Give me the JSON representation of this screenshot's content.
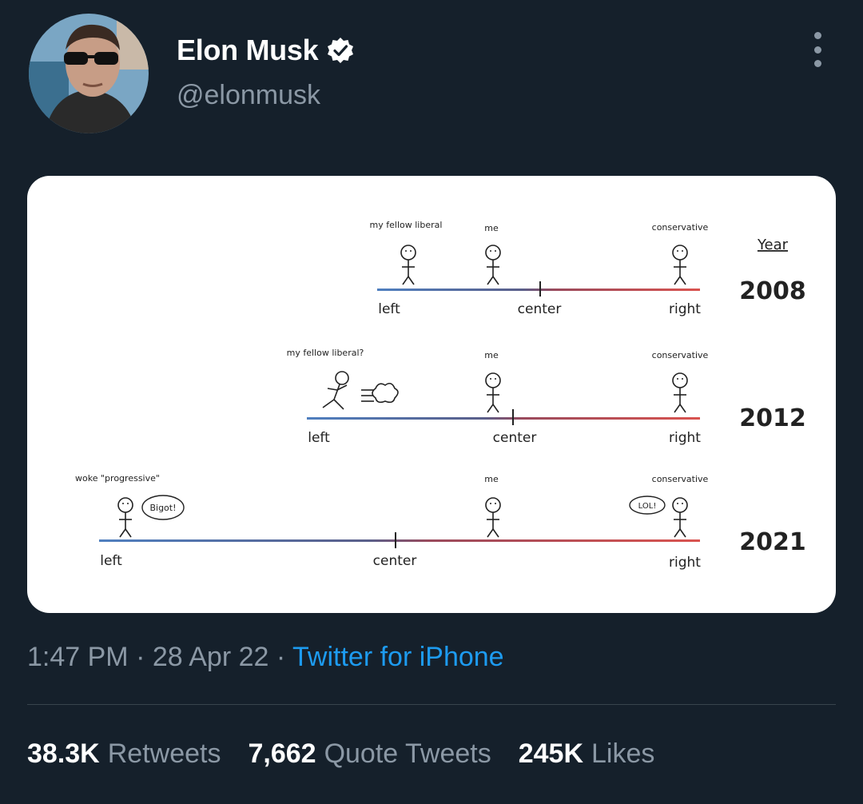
{
  "author": {
    "name": "Elon Musk",
    "handle": "@elonmusk",
    "verified": true
  },
  "meme": {
    "year_header": "Year",
    "panels": [
      {
        "year": "2008",
        "labels": {
          "left": "left",
          "center": "center",
          "right": "right"
        },
        "figures": {
          "liberal": "my fellow liberal",
          "me": "me",
          "conservative": "conservative"
        }
      },
      {
        "year": "2012",
        "labels": {
          "left": "left",
          "center": "center",
          "right": "right"
        },
        "figures": {
          "liberal": "my fellow liberal?",
          "me": "me",
          "conservative": "conservative"
        }
      },
      {
        "year": "2021",
        "labels": {
          "left": "left",
          "center": "center",
          "right": "right"
        },
        "figures": {
          "liberal": "woke \"progressive\"",
          "me": "me",
          "conservative": "conservative"
        },
        "speech_left": "Bigot!",
        "speech_right": "LOL!"
      }
    ]
  },
  "meta": {
    "time": "1:47 PM",
    "date": "28 Apr 22",
    "sep": " · ",
    "source": "Twitter for iPhone"
  },
  "stats": {
    "retweets_count": "38.3K",
    "retweets_label": "Retweets",
    "quotes_count": "7,662",
    "quotes_label": "Quote Tweets",
    "likes_count": "245K",
    "likes_label": "Likes"
  },
  "colors": {
    "background": "#15202b",
    "secondary_text": "#8b98a5",
    "link": "#1d9bf0",
    "verified": "#ffffff",
    "left_line": "#4f7fbf",
    "right_line": "#d9534f"
  },
  "icons": {
    "verified": "verified-badge-icon",
    "more": "more-options-icon"
  }
}
